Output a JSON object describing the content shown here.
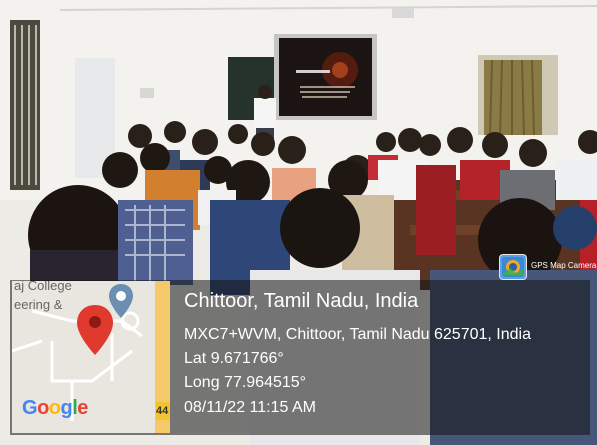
{
  "map": {
    "label_top": "aj College",
    "label_second": "eering &",
    "road_number": "44",
    "brand": [
      "G",
      "o",
      "o",
      "g",
      "l",
      "e"
    ]
  },
  "location": {
    "title": "Chittoor, Tamil Nadu, India",
    "address": "MXC7+WVM, Chittoor, Tamil Nadu 625701, India",
    "lat": "Lat 9.671766°",
    "long": "Long 77.964515°",
    "datetime": "08/11/22 11:15 AM"
  },
  "app": {
    "name": "GPS Map Camera",
    "icon": "gps-map-camera-icon"
  },
  "colors": {
    "overlay": "#1414148c",
    "pin": "#e03a2f"
  }
}
